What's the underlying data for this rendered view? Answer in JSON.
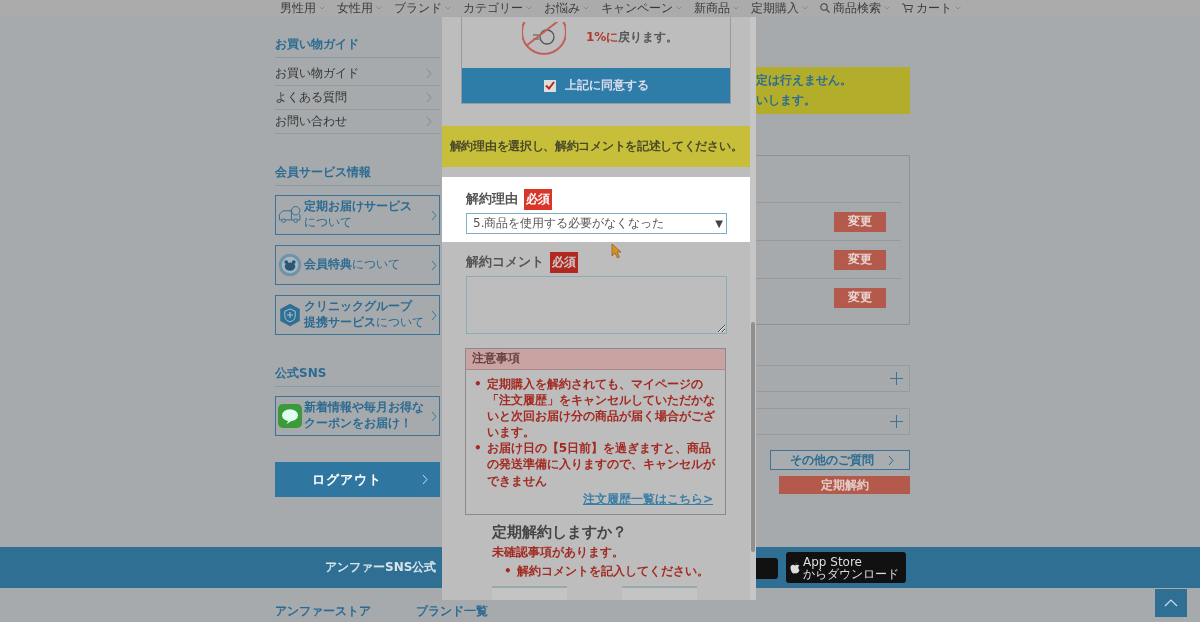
{
  "nav": [
    {
      "label": "男性用",
      "kind": "menu"
    },
    {
      "label": "女性用",
      "kind": "menu"
    },
    {
      "label": "ブランド",
      "kind": "menu"
    },
    {
      "label": "カテゴリー",
      "kind": "menu"
    },
    {
      "label": "お悩み",
      "kind": "menu"
    },
    {
      "label": "キャンペーン",
      "kind": "menu"
    },
    {
      "label": "新商品",
      "kind": "menu"
    },
    {
      "label": "定期購入",
      "kind": "menu"
    },
    {
      "label": "商品検索",
      "kind": "search"
    },
    {
      "label": "カート",
      "kind": "cart"
    }
  ],
  "sidebar": {
    "sections": [
      {
        "title": "お買い物ガイド",
        "kind": "links",
        "items": [
          {
            "text": "お買い物ガイド"
          },
          {
            "text": "よくある質問"
          },
          {
            "text": "お問い合わせ"
          }
        ]
      },
      {
        "title": "会員サービス情報",
        "kind": "cards",
        "items": [
          {
            "kind": "truck",
            "lines": [
              {
                "text": "定期お届けサービス"
              },
              {
                "note": "について"
              }
            ]
          },
          {
            "kind": "seal",
            "lines": [
              {
                "text": "会員特典",
                "note": "について"
              }
            ]
          },
          {
            "kind": "shield",
            "lines": [
              {
                "text": "クリニックグループ"
              },
              {
                "text": "提携サービス",
                "note": "について"
              }
            ]
          }
        ]
      },
      {
        "title": "公式SNS",
        "kind": "cards",
        "items": [
          {
            "kind": "line",
            "lines": [
              {
                "text": "新着情報や毎月お得な"
              },
              {
                "text": "クーポンをお届け！"
              }
            ]
          }
        ]
      }
    ],
    "logout": "ログアウト"
  },
  "content": {
    "notice": [
      "定は行えません。",
      "いします。"
    ],
    "change_buttons": [
      "変更",
      "変更",
      "変更"
    ],
    "accordions": [
      {
        "expanded": false
      },
      {
        "expanded": false
      }
    ],
    "faq_button": "その他のご質問",
    "cancel_button": "定期解約"
  },
  "modal": {
    "point_notice": {
      "highlight": "1%に",
      "text": "戻ります。"
    },
    "agree": {
      "label": "上記に同意する",
      "checked": true
    },
    "instruction": "解約理由を選択し、解約コメントを記述してください。",
    "reason": {
      "label": "解約理由",
      "badge": "必須",
      "value": "5.商品を使用する必要がなくなった",
      "arrow": "▼"
    },
    "comment": {
      "label": "解約コメント",
      "badge": "必須"
    },
    "notes": {
      "title": "注意事項",
      "bullet": "•",
      "items": [
        "定期購入を解約されても、マイページの「注文履歴」をキャンセルしていただかないと次回お届け分の商品が届く場合がございます。",
        "お届け日の【5日前】を過ぎますと、商品の発送準備に入りますので、キャンセルができません"
      ],
      "link": "注文履歴一覧はこちら>"
    },
    "confirm": {
      "title": "定期解約しますか？",
      "warning": "未確認事項があります。",
      "bullet": "•",
      "items": [
        "解約コメントを記入してください。"
      ]
    }
  },
  "footer": {
    "sns_text": "アンファーSNS公式",
    "app_store": {
      "title": "App Store",
      "subtitle": "からダウンロード"
    },
    "links": [
      "アンファーストア",
      "ブランド一覧"
    ]
  }
}
